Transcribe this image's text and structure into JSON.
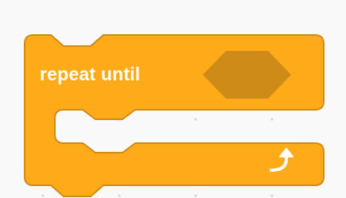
{
  "block": {
    "category": "control",
    "label": "repeat until",
    "condition_slot": "empty-boolean-slot",
    "loop_icon": "loop-arrow-icon",
    "colors": {
      "fill": "#FFAB19",
      "border": "#CF8B17",
      "slot": "#CF8B17",
      "canvas": "#F9F9F9",
      "canvas_dot": "#D6D6D6",
      "text": "#FFFFFF"
    }
  }
}
